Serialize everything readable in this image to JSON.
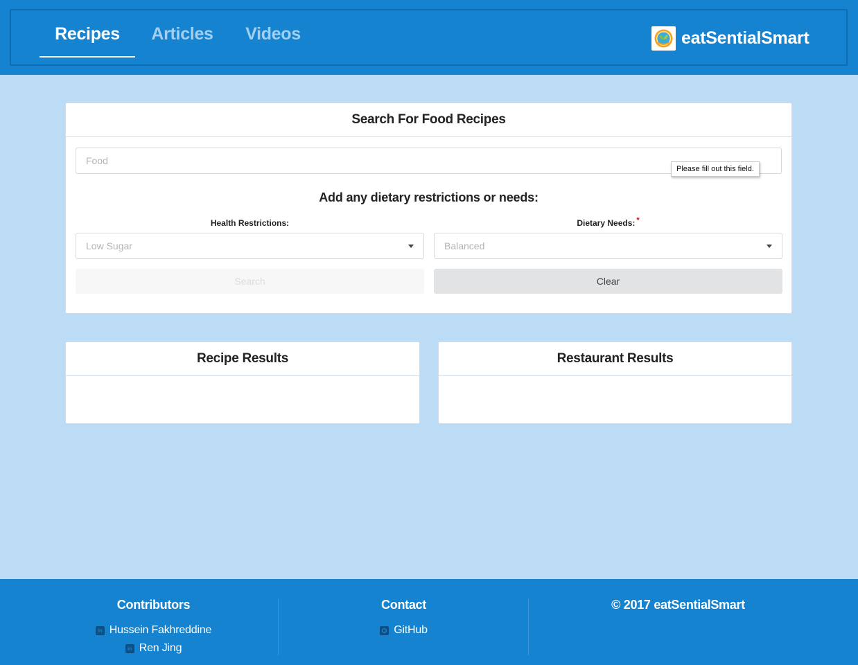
{
  "header": {
    "tabs": [
      {
        "label": "Recipes",
        "active": true
      },
      {
        "label": "Articles",
        "active": false
      },
      {
        "label": "Videos",
        "active": false
      }
    ],
    "brand": {
      "name": "eatSentialSmart",
      "logo_icon": "orange-leaf-logo-icon"
    }
  },
  "search_card": {
    "title": "Search For Food Recipes",
    "food_input": {
      "placeholder": "Food",
      "value": ""
    },
    "validation_tooltip": "Please fill out this field.",
    "subheading": "Add any dietary restrictions or needs:",
    "health_restrictions": {
      "label": "Health Restrictions:",
      "selected": "Low Sugar"
    },
    "dietary_needs": {
      "label": "Dietary Needs:",
      "required_marker": "*",
      "selected": "Balanced"
    },
    "search_button": "Search",
    "clear_button": "Clear"
  },
  "results": {
    "recipe_title": "Recipe Results",
    "restaurant_title": "Restaurant Results"
  },
  "footer": {
    "contributors": {
      "heading": "Contributors",
      "links": [
        {
          "label": "Hussein Fakhreddine",
          "icon": "linkedin-icon"
        },
        {
          "label": "Ren Jing",
          "icon": "linkedin-icon"
        }
      ]
    },
    "contact": {
      "heading": "Contact",
      "links": [
        {
          "label": "GitHub",
          "icon": "github-icon"
        }
      ]
    },
    "copyright": "© 2017 eatSentialSmart"
  },
  "colors": {
    "header_blue": "#1583d0",
    "page_background": "#bcdcf6",
    "required_red": "#d0021b"
  }
}
